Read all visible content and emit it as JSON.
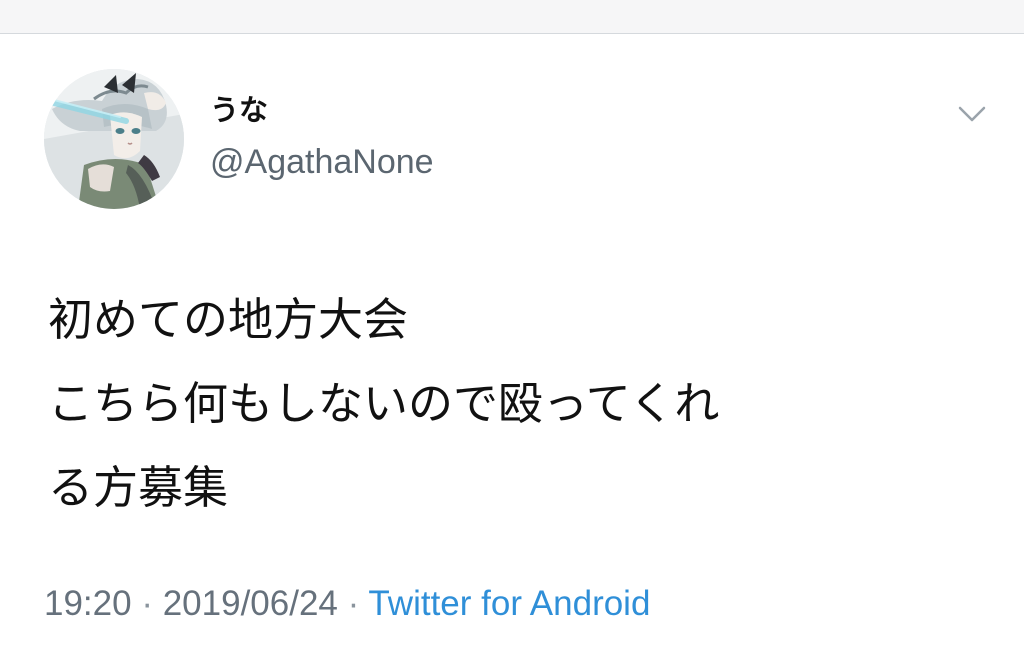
{
  "tweet": {
    "author": {
      "display_name": "うな",
      "handle": "@AgathaNone",
      "avatar_icon": "anime-girl-avatar-icon"
    },
    "menu_icon": "chevron-down-icon",
    "text_lines": [
      "初めての地方大会",
      "こちら何もしないので殴ってくれ",
      "る方募集"
    ],
    "time": "19:20",
    "date": "2019/06/24",
    "separator": " · ",
    "source": "Twitter for Android"
  },
  "colors": {
    "background": "#ffffff",
    "text": "#111111",
    "secondary_text": "#5b6670",
    "link": "#2f8fd8",
    "divider": "#d5d9dd"
  }
}
